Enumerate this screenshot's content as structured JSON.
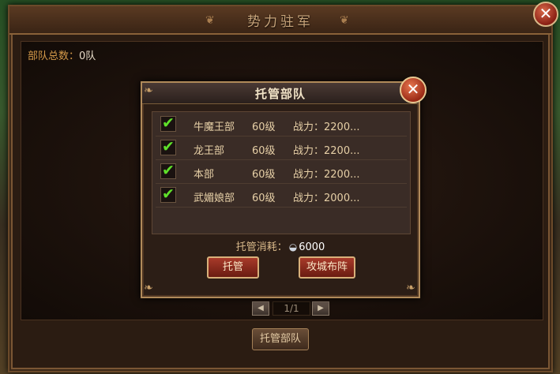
{
  "main_window": {
    "title": "势力驻军",
    "troop_count_label": "部队总数：",
    "troop_count_value": "0队",
    "close_label": "✕",
    "pager": {
      "prev": "◀",
      "text": "1/1",
      "next": "▶"
    },
    "bottom_button": "托管部队"
  },
  "dialog": {
    "title": "托管部队",
    "close_label": "✕",
    "troops": [
      {
        "checked": true,
        "check_mark": "✔",
        "name": "牛魔王部",
        "level": "60级",
        "power": "战力：2200..."
      },
      {
        "checked": true,
        "check_mark": "✔",
        "name": "龙王部",
        "level": "60级",
        "power": "战力：2200..."
      },
      {
        "checked": true,
        "check_mark": "✔",
        "name": "本部",
        "level": "60级",
        "power": "战力：2200..."
      },
      {
        "checked": true,
        "check_mark": "✔",
        "name": "武媚娘部",
        "level": "60级",
        "power": "战力：2000..."
      }
    ],
    "cost_label": "托管消耗：",
    "cost_icon": "silver-ingot-icon",
    "cost_value": "6000",
    "host_button": "托管",
    "formation_button": "攻城布阵"
  }
}
